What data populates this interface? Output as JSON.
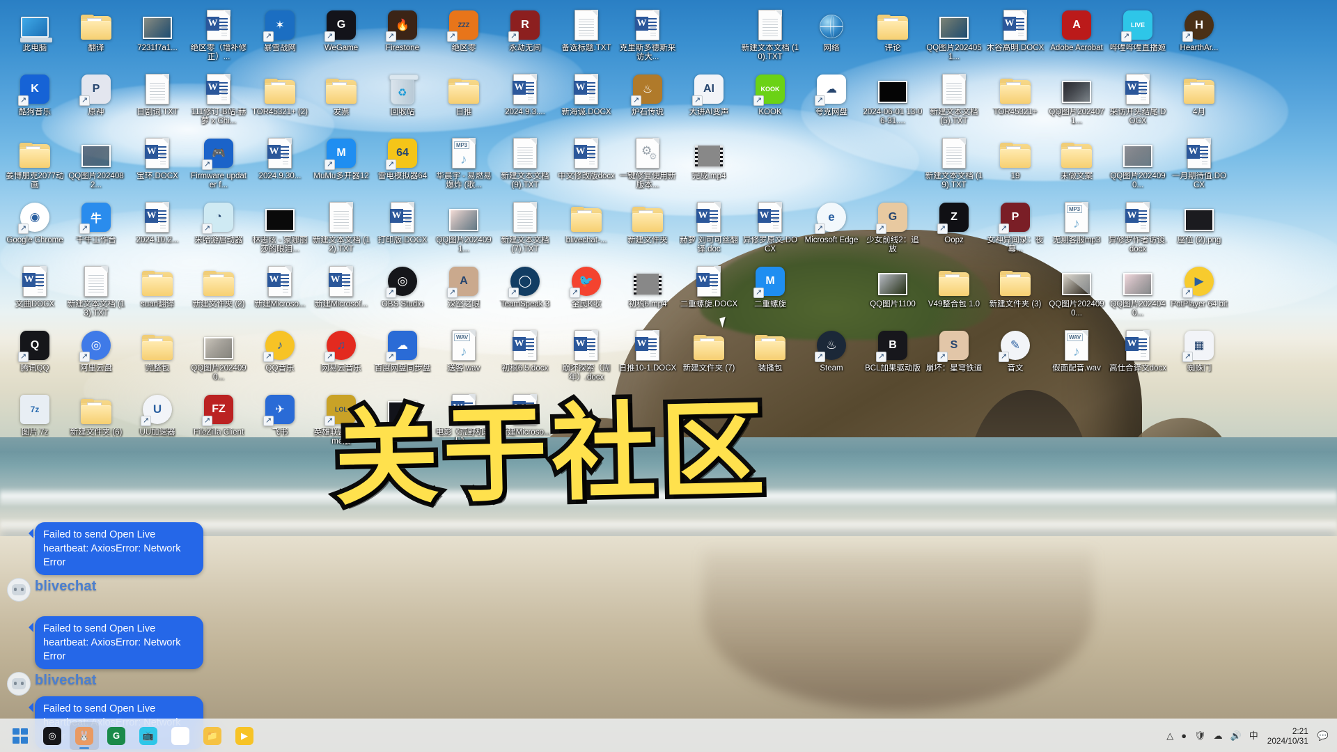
{
  "desktop": {
    "overlay_title": "关于社区",
    "cursor_label": "mouse-pointer",
    "icons": [
      {
        "label": "此电脑",
        "type": "this-pc",
        "shortcut": false
      },
      {
        "label": "翻译",
        "type": "folder",
        "shortcut": false
      },
      {
        "label": "7231f7a1...",
        "type": "thumb",
        "shortcut": false,
        "color": "#8a8f86"
      },
      {
        "label": "绝区零（增补修正）...",
        "type": "word",
        "shortcut": false
      },
      {
        "label": "暴雪战网",
        "type": "tile",
        "shortcut": true,
        "color": "#1b6ec2",
        "glyph": "✶"
      },
      {
        "label": "WeGame",
        "type": "tile",
        "shortcut": true,
        "color": "#13131a",
        "glyph": "G"
      },
      {
        "label": "Firestone",
        "type": "tile",
        "shortcut": true,
        "color": "#3b2416",
        "glyph": "🔥"
      },
      {
        "label": "绝区零",
        "type": "tile",
        "shortcut": true,
        "color": "#e8751a",
        "glyph": "ZZZ"
      },
      {
        "label": "永劫无间",
        "type": "tile",
        "shortcut": true,
        "color": "#8c1f1f",
        "glyph": "R"
      },
      {
        "label": "备选标题.TXT",
        "type": "txt",
        "shortcut": false
      },
      {
        "label": "克里斯多德斯采访大...",
        "type": "word",
        "shortcut": false
      },
      {
        "label": "",
        "type": "blank",
        "shortcut": false
      },
      {
        "label": "新建文本文档 (10).TXT",
        "type": "txt",
        "shortcut": false
      },
      {
        "label": "网络",
        "type": "network",
        "shortcut": false
      },
      {
        "label": "评论",
        "type": "folder",
        "shortcut": false
      },
      {
        "label": "QQ图片2024051...",
        "type": "thumb",
        "shortcut": false,
        "color": "#7d8578"
      },
      {
        "label": "木谷高明.DOCX",
        "type": "word",
        "shortcut": false
      },
      {
        "label": "Adobe Acrobat",
        "type": "tile",
        "shortcut": false,
        "color": "#bb1a1a",
        "glyph": "A"
      },
      {
        "label": "哔哩哔哩直播姬",
        "type": "tile",
        "shortcut": true,
        "color": "#2ec6e8",
        "glyph": "LIVE"
      },
      {
        "label": "HearthAr...",
        "type": "tile-circle",
        "shortcut": true,
        "color": "#4a3016",
        "glyph": "H"
      },
      {
        "label": "酷狗音乐",
        "type": "tile",
        "shortcut": true,
        "color": "#1663d6",
        "glyph": "K"
      },
      {
        "label": "原神",
        "type": "tile",
        "shortcut": true,
        "color": "#e3e6ef",
        "glyph": "P"
      },
      {
        "label": "日剧词.TXT",
        "type": "txt",
        "shortcut": false
      },
      {
        "label": "111修订-B站-赫萝 x Chi...",
        "type": "word",
        "shortcut": false
      },
      {
        "label": "TOR45321+ (2)",
        "type": "folder",
        "shortcut": false
      },
      {
        "label": "发票",
        "type": "folder",
        "shortcut": false
      },
      {
        "label": "回收站",
        "type": "bin",
        "shortcut": false
      },
      {
        "label": "日推",
        "type": "folder",
        "shortcut": false
      },
      {
        "label": "2024.9.3....",
        "type": "word",
        "shortcut": false
      },
      {
        "label": "新海诚.DOCX",
        "type": "word",
        "shortcut": false
      },
      {
        "label": "炉石传说",
        "type": "tile",
        "shortcut": true,
        "color": "#b07a2a",
        "glyph": "♨"
      },
      {
        "label": "大讲AI变声",
        "type": "tile",
        "shortcut": true,
        "color": "#f2f4f8",
        "glyph": "AI"
      },
      {
        "label": "KOOK",
        "type": "tile",
        "shortcut": true,
        "color": "#6bd216",
        "glyph": "KOOK"
      },
      {
        "label": "夸克网盘",
        "type": "tile",
        "shortcut": true,
        "color": "#ffffff",
        "glyph": "☁"
      },
      {
        "label": "2024-06-01 13-06-31....",
        "type": "thumb-dark",
        "shortcut": false,
        "color": "#050505"
      },
      {
        "label": "新建文本文档 (5).TXT",
        "type": "txt",
        "shortcut": false
      },
      {
        "label": "TOR45321+",
        "type": "folder",
        "shortcut": false
      },
      {
        "label": "QQ图片2024071...",
        "type": "thumb",
        "shortcut": false,
        "color": "#2a2a30"
      },
      {
        "label": "采访开头结尾.DOCX",
        "type": "word",
        "shortcut": false
      },
      {
        "label": "4月",
        "type": "folder",
        "shortcut": false
      },
      {
        "label": "姜博朋克2077动画",
        "type": "folder",
        "shortcut": false
      },
      {
        "label": "QQ图片2024082...",
        "type": "thumb",
        "shortcut": false,
        "color": "#5f7186"
      },
      {
        "label": "宝环.DOCX",
        "type": "word",
        "shortcut": false
      },
      {
        "label": "Firmware updater f...",
        "type": "tile",
        "shortcut": true,
        "color": "#1b63c9",
        "glyph": "🎮"
      },
      {
        "label": "2024.9.30...",
        "type": "word",
        "shortcut": false
      },
      {
        "label": "MuMu多开器12",
        "type": "tile",
        "shortcut": true,
        "color": "#1f8ef1",
        "glyph": "M"
      },
      {
        "label": "雷电模拟器64",
        "type": "tile",
        "shortcut": true,
        "color": "#f5c518",
        "glyph": "64"
      },
      {
        "label": "华晨宇 - 易燃易爆炸 (歌...",
        "type": "mp3",
        "shortcut": false
      },
      {
        "label": "新建文本文档 (9).TXT",
        "type": "txt",
        "shortcut": false
      },
      {
        "label": "中文修改版docx",
        "type": "word",
        "shortcut": false
      },
      {
        "label": "一键修复使用新版本...",
        "type": "settings-doc",
        "shortcut": false
      },
      {
        "label": "完成.mp4",
        "type": "video",
        "shortcut": false
      },
      {
        "label": "",
        "type": "blank",
        "shortcut": false
      },
      {
        "label": "",
        "type": "blank",
        "shortcut": false
      },
      {
        "label": "新建文本文档 (19).TXT",
        "type": "txt",
        "shortcut": false,
        "col": 16
      },
      {
        "label": "19",
        "type": "folder",
        "shortcut": false
      },
      {
        "label": "未做文案",
        "type": "folder",
        "shortcut": false
      },
      {
        "label": "QQ图片2024090...",
        "type": "thumb",
        "shortcut": false,
        "color": "#8d8f96"
      },
      {
        "label": "一月期待值.DOCX",
        "type": "word",
        "shortcut": false
      },
      {
        "label": "Google Chrome",
        "type": "tile-circle",
        "shortcut": true,
        "color": "#ffffff",
        "glyph": "◉"
      },
      {
        "label": "千牛工作台",
        "type": "tile",
        "shortcut": true,
        "color": "#2a8ced",
        "glyph": "牛"
      },
      {
        "label": "2024.10.2...",
        "type": "word",
        "shortcut": false
      },
      {
        "label": "米哈游启动器",
        "type": "tile",
        "shortcut": true,
        "color": "#cfeaf3",
        "glyph": "◔"
      },
      {
        "label": "林志炫 - 蒙娜丽莎的眼泪...",
        "type": "thumb-dark",
        "shortcut": false,
        "color": "#0a0a0a"
      },
      {
        "label": "新建文本文档 (12).TXT",
        "type": "txt",
        "shortcut": false
      },
      {
        "label": "打印版.DOCX",
        "type": "word",
        "shortcut": false
      },
      {
        "label": "QQ图片2024091...",
        "type": "thumb",
        "shortcut": false,
        "color": "#f4dcd6"
      },
      {
        "label": "新建文本文档 (7).TXT",
        "type": "txt",
        "shortcut": false
      },
      {
        "label": "blivechat-...",
        "type": "folder",
        "shortcut": false
      },
      {
        "label": "新建文件夹",
        "type": "folder",
        "shortcut": false
      },
      {
        "label": "赫萝 刘可可丝翻译.doc",
        "type": "word",
        "shortcut": false
      },
      {
        "label": "异修罗原文.DOCX",
        "type": "word",
        "shortcut": false
      },
      {
        "label": "Microsoft Edge",
        "type": "tile-circle",
        "shortcut": true,
        "color": "#f2f8fc",
        "glyph": "e"
      },
      {
        "label": "少女前线2：追放",
        "type": "tile",
        "shortcut": true,
        "color": "#e8c9a0",
        "glyph": "G"
      },
      {
        "label": "Oopz",
        "type": "tile",
        "shortcut": true,
        "color": "#101014",
        "glyph": "Z"
      },
      {
        "label": "女神异闻录：夜幕...",
        "type": "tile",
        "shortcut": true,
        "color": "#7a1e26",
        "glyph": "P"
      },
      {
        "label": "无期客服mp3",
        "type": "mp3",
        "shortcut": false
      },
      {
        "label": "异修罗作者访谈.docx",
        "type": "word",
        "shortcut": false
      },
      {
        "label": "座位 (2).png",
        "type": "thumb-dark",
        "shortcut": false,
        "color": "#1b1b1f"
      },
      {
        "label": "文曲DOCX",
        "type": "word",
        "shortcut": false
      },
      {
        "label": "新建文本文档 (13).TXT",
        "type": "txt",
        "shortcut": false
      },
      {
        "label": "suan翻译",
        "type": "folder",
        "shortcut": false
      },
      {
        "label": "新建文件夹 (2)",
        "type": "folder",
        "shortcut": false
      },
      {
        "label": "新建Microso...",
        "type": "word",
        "shortcut": false
      },
      {
        "label": "新建Microsof...",
        "type": "word",
        "shortcut": false
      },
      {
        "label": "OBS Studio",
        "type": "tile-circle",
        "shortcut": true,
        "color": "#15161a",
        "glyph": "◎"
      },
      {
        "label": "深空之眼",
        "type": "tile",
        "shortcut": true,
        "color": "#caa98d",
        "glyph": "A"
      },
      {
        "label": "TeamSpeak 3",
        "type": "tile-circle",
        "shortcut": true,
        "color": "#123d63",
        "glyph": "◯"
      },
      {
        "label": "全民K歌",
        "type": "tile-circle",
        "shortcut": true,
        "color": "#f4432f",
        "glyph": "🐦"
      },
      {
        "label": "初稿6.mp4",
        "type": "video",
        "shortcut": false
      },
      {
        "label": "二重螺旋.DOCX",
        "type": "word",
        "shortcut": false
      },
      {
        "label": "二重螺旋",
        "type": "tile",
        "shortcut": true,
        "color": "#1f8ef1",
        "glyph": "M"
      },
      {
        "label": "",
        "type": "blank",
        "shortcut": false
      },
      {
        "label": "QQ图片1100",
        "type": "thumb",
        "shortcut": false,
        "color": "#b8bcc4"
      },
      {
        "label": "V49整合包 1.0",
        "type": "folder",
        "shortcut": false
      },
      {
        "label": "新建文件夹 (3)",
        "type": "folder",
        "shortcut": false
      },
      {
        "label": "QQ图片2024090...",
        "type": "thumb",
        "shortcut": false,
        "color": "#dcd7cd"
      },
      {
        "label": "QQ图片2024040...",
        "type": "thumb",
        "shortcut": false,
        "color": "#f2d9de"
      },
      {
        "label": "PotPlayer 64 bit",
        "type": "tile-circle",
        "shortcut": true,
        "color": "#f7cb2e",
        "glyph": "▶"
      },
      {
        "label": "腾讯QQ",
        "type": "tile",
        "shortcut": true,
        "color": "#15161a",
        "glyph": "Q"
      },
      {
        "label": "阿里云盘",
        "type": "tile-circle",
        "shortcut": true,
        "color": "#3f7ae8",
        "glyph": "◎"
      },
      {
        "label": "完整包",
        "type": "folder",
        "shortcut": false
      },
      {
        "label": "QQ图片2024090...",
        "type": "thumb",
        "shortcut": false,
        "color": "#cbc6bc"
      },
      {
        "label": "QQ音乐",
        "type": "tile-circle",
        "shortcut": true,
        "color": "#f7c325",
        "glyph": "♪"
      },
      {
        "label": "网易云音乐",
        "type": "tile-circle",
        "shortcut": true,
        "color": "#e32a1f",
        "glyph": "♫"
      },
      {
        "label": "百度网盘同步盘",
        "type": "tile",
        "shortcut": true,
        "color": "#2a6bd6",
        "glyph": "☁"
      },
      {
        "label": "送客.wav",
        "type": "wav",
        "shortcut": false
      },
      {
        "label": "初稿6.5.docx",
        "type": "word",
        "shortcut": false
      },
      {
        "label": "崩坏探索（周年）.docx",
        "type": "word",
        "shortcut": false
      },
      {
        "label": "日推10-1.DOCX",
        "type": "word",
        "shortcut": false
      },
      {
        "label": "新建文件夹 (7)",
        "type": "folder",
        "shortcut": false
      },
      {
        "label": "装播包",
        "type": "folder",
        "shortcut": false
      },
      {
        "label": "Steam",
        "type": "tile-circle",
        "shortcut": true,
        "color": "#1b2838",
        "glyph": "♨"
      },
      {
        "label": "BCL加果驱动版",
        "type": "tile",
        "shortcut": true,
        "color": "#17171c",
        "glyph": "B"
      },
      {
        "label": "崩坏：星穹铁道",
        "type": "tile",
        "shortcut": true,
        "color": "#e2c6a8",
        "glyph": "S"
      },
      {
        "label": "音文",
        "type": "tile-circle",
        "shortcut": true,
        "color": "#f2f4f8",
        "glyph": "✎"
      },
      {
        "label": "假面配音.wav",
        "type": "wav",
        "shortcut": false
      },
      {
        "label": "高仕合译文docx",
        "type": "word",
        "shortcut": false
      },
      {
        "label": "蜘蛛门",
        "type": "tile",
        "shortcut": true,
        "color": "#f2f4f8",
        "glyph": "▦"
      },
      {
        "label": "图片.7z",
        "type": "archive",
        "shortcut": false
      },
      {
        "label": "新建文件夹 (6)",
        "type": "folder",
        "shortcut": false
      },
      {
        "label": "UU加速器",
        "type": "tile-circle",
        "shortcut": true,
        "color": "#f2f4f8",
        "glyph": "U"
      },
      {
        "label": "FileZilla Client",
        "type": "tile",
        "shortcut": true,
        "color": "#bb2222",
        "glyph": "FZ"
      },
      {
        "label": "飞书",
        "type": "tile",
        "shortcut": true,
        "color": "#2a6bd6",
        "glyph": "✈"
      },
      {
        "label": "英雄联盟WeGame版",
        "type": "tile",
        "shortcut": true,
        "color": "#c9a227",
        "glyph": "LOL"
      },
      {
        "label": "915.png",
        "type": "thumb-dark",
        "shortcut": false,
        "color": "#12131a"
      },
      {
        "label": "电影《荒野机器人》...",
        "type": "word",
        "shortcut": false
      },
      {
        "label": "新建Microso...",
        "type": "word",
        "shortcut": false
      }
    ]
  },
  "toasts": {
    "username": "blivechat",
    "messages": [
      "Failed to send Open Live heartbeat: AxiosError: Network Error",
      "Failed to send Open Live heartbeat: AxiosError: Network Error",
      "Failed to send Open Live heartbeat: AxiosError: Network Error"
    ]
  },
  "taskbar": {
    "start_label": "start-button",
    "buttons": [
      {
        "name": "start",
        "glyph": "",
        "color": "#2f7fd1",
        "active": false
      },
      {
        "name": "obs-studio",
        "glyph": "◎",
        "color": "#15161a",
        "active": false
      },
      {
        "name": "blivechat",
        "glyph": "🐰",
        "color": "#e99a63",
        "active": true
      },
      {
        "name": "app-green",
        "glyph": "G",
        "color": "#1a8a4a",
        "active": false
      },
      {
        "name": "bilibili",
        "glyph": "📺",
        "color": "#2ec6e8",
        "active": false
      },
      {
        "name": "google-chrome",
        "glyph": "◉",
        "color": "#ffffff",
        "active": false
      },
      {
        "name": "file-explorer",
        "glyph": "📁",
        "color": "#f5c244",
        "active": false
      },
      {
        "name": "video-app",
        "glyph": "▶",
        "color": "#f7c325",
        "active": false
      }
    ],
    "tray": {
      "icons": [
        "chevron-up",
        "ime",
        "shield",
        "network",
        "volume",
        "lang"
      ],
      "lang_label": "中",
      "time": "2:21",
      "date": "2024/10/31"
    }
  }
}
